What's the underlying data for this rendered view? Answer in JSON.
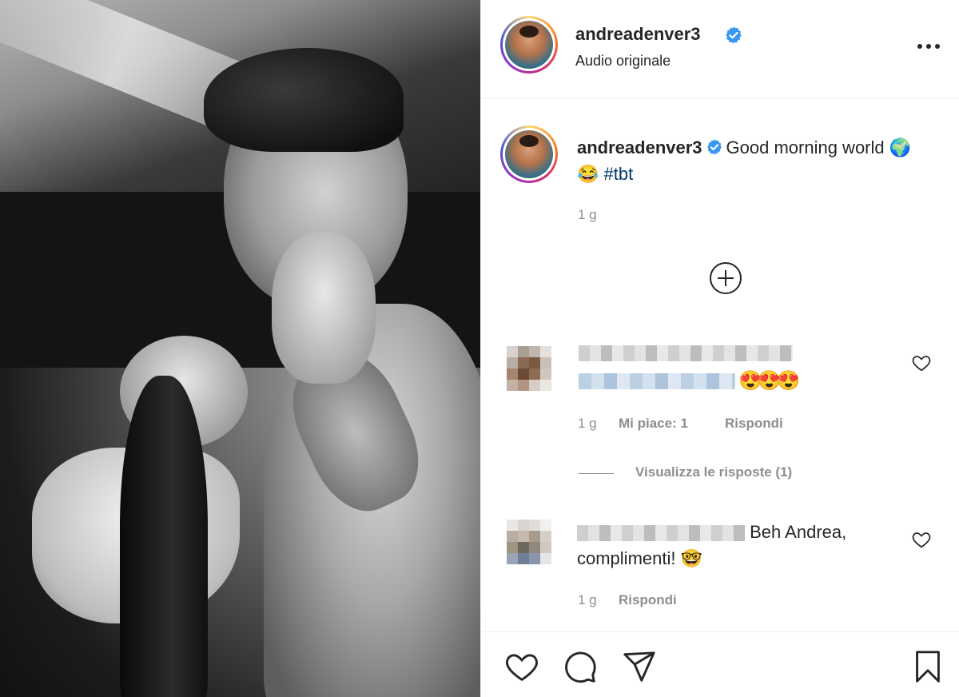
{
  "post": {
    "username": "andreadenver3",
    "audio": "Audio originale",
    "caption_text": "Good morning world",
    "caption_emoji": "🌍😂",
    "caption_hashtag": "#tbt",
    "time": "1 g"
  },
  "comments": [
    {
      "text_suffix_emoji": "😍😍😍",
      "time": "1 g",
      "likes": "Mi piace: 1",
      "reply": "Rispondi",
      "view_replies": "Visualizza le risposte (1)"
    },
    {
      "text": "Beh Andrea, complimenti!",
      "emoji": "🤓",
      "time": "1 g",
      "reply": "Rispondi"
    }
  ],
  "colors": {
    "verified_blue": "#3897f0",
    "text_primary": "#262626",
    "text_secondary": "#8e8e8e",
    "hashtag": "#00376b"
  },
  "icons": [
    "more-options-icon",
    "verified-badge-icon",
    "load-more-comments-icon",
    "heart-icon",
    "comment-icon",
    "share-icon",
    "bookmark-icon"
  ]
}
